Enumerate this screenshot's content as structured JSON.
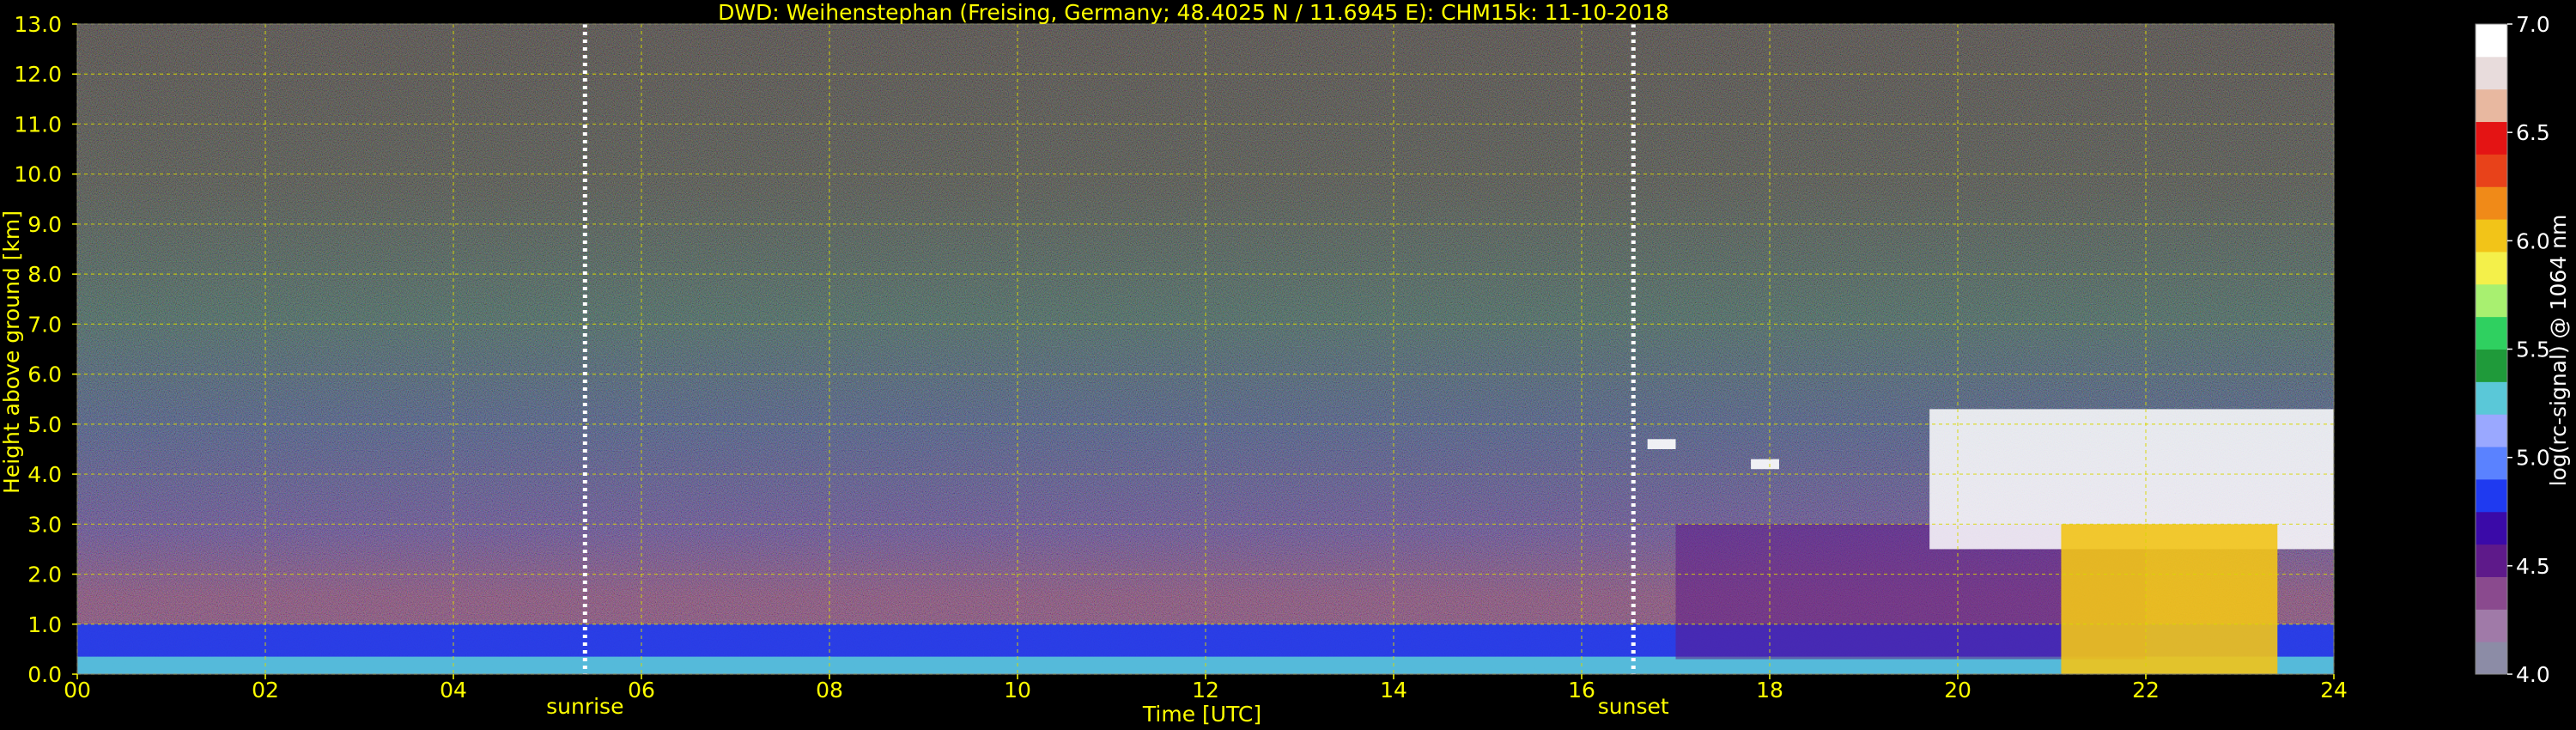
{
  "chart_data": {
    "type": "heatmap",
    "title": "DWD: Weihenstephan (Freising, Germany; 48.4025 N / 11.6945 E):    CHM15k: 11-10-2018",
    "xlabel": "Time [UTC]",
    "ylabel": "Height above ground [km]",
    "xlim": [
      0,
      24
    ],
    "ylim": [
      0,
      13
    ],
    "x_ticks": [
      "00",
      "02",
      "04",
      "06",
      "08",
      "10",
      "12",
      "14",
      "16",
      "18",
      "20",
      "22",
      "24"
    ],
    "y_ticks": [
      "0.0",
      "1.0",
      "2.0",
      "3.0",
      "4.0",
      "5.0",
      "6.0",
      "7.0",
      "8.0",
      "9.0",
      "10.0",
      "11.0",
      "12.0",
      "13.0"
    ],
    "grid": true,
    "markers": [
      {
        "label": "sunrise",
        "time": 5.4
      },
      {
        "label": "sunset",
        "time": 16.55
      }
    ],
    "colorbar": {
      "label": "log(rc-signal) @ 1064 nm",
      "range": [
        4.0,
        7.0
      ],
      "ticks": [
        "4.0",
        "4.5",
        "5.0",
        "5.5",
        "6.0",
        "6.5",
        "7.0"
      ],
      "colors": [
        "#8c8ca6",
        "#a07aa8",
        "#8a4a8e",
        "#5e1a8a",
        "#3a0aa8",
        "#1f3af0",
        "#5a82ff",
        "#9aa8ff",
        "#5ac8d8",
        "#1f9a3a",
        "#2fd060",
        "#a8f070",
        "#f4f04a",
        "#f2c418",
        "#f08a18",
        "#e8421a",
        "#e41414",
        "#e8b8a0",
        "#e8dcdc",
        "#ffffff"
      ]
    },
    "features": [
      {
        "name": "boundary-layer",
        "time_range": [
          0,
          24
        ],
        "height_range": [
          0,
          1.0
        ],
        "level": 4.8
      },
      {
        "name": "surface-layer",
        "time_range": [
          0,
          24
        ],
        "height_range": [
          0,
          0.35
        ],
        "level": 5.3
      },
      {
        "name": "residual-layer",
        "time_range": [
          17,
          22
        ],
        "height_range": [
          0.3,
          3.0
        ],
        "level": 4.6
      },
      {
        "name": "cloud-patch",
        "time_range": [
          16.7,
          17.0
        ],
        "height_range": [
          4.5,
          4.7
        ],
        "level": 7.0
      },
      {
        "name": "cloud-patch",
        "time_range": [
          17.8,
          18.1
        ],
        "height_range": [
          4.1,
          4.3
        ],
        "level": 7.0
      },
      {
        "name": "cloud-layer",
        "time_range": [
          19.7,
          24
        ],
        "height_range": [
          2.5,
          5.3
        ],
        "level": 7.0
      },
      {
        "name": "precipitation",
        "time_range": [
          21.1,
          23.4
        ],
        "height_range": [
          0,
          3.0
        ],
        "level": 6.0
      }
    ]
  }
}
